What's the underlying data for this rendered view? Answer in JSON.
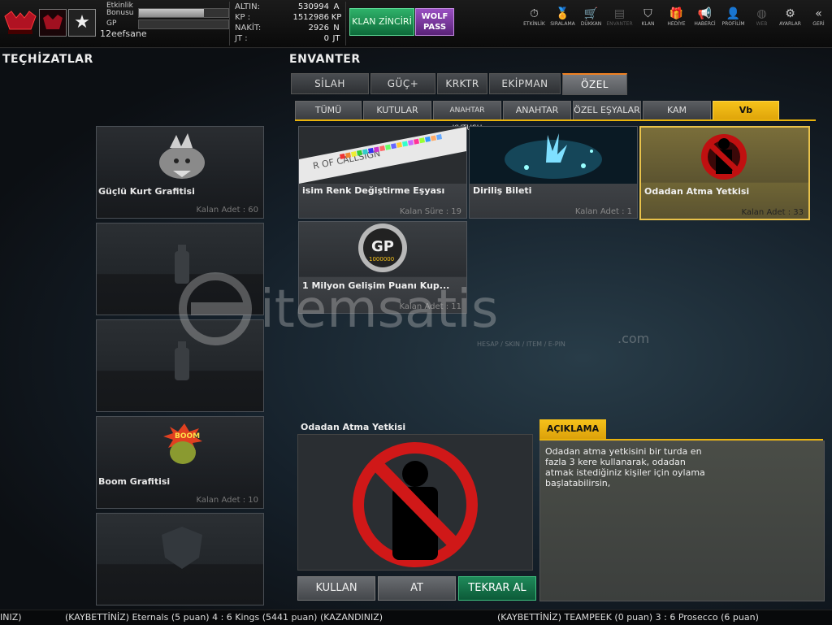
{
  "player": {
    "name": "12eefsane",
    "bonus_label": "Etkinlik Bonusu",
    "bonus_fill": 0.73,
    "gp_label": "GP",
    "gp_fill": 0.0
  },
  "currency": [
    {
      "label": "ALTIN:",
      "value": "530994",
      "unit": "A"
    },
    {
      "label": "KP   :",
      "value": "1512986",
      "unit": "KP"
    },
    {
      "label": "NAKİT:",
      "value": "2926",
      "unit": "N"
    },
    {
      "label": "JT   :",
      "value": "0",
      "unit": "JT"
    }
  ],
  "buttons": {
    "klan": "KLAN ZİNCİRİ",
    "wolf": "WOLF PASS"
  },
  "top_menu": [
    {
      "label": "ETKİNLİK",
      "icon": "stopwatch-icon",
      "glyph": "⏱",
      "dim": false
    },
    {
      "label": "SIRALAMA",
      "icon": "medal-icon",
      "glyph": "🏅",
      "dim": false
    },
    {
      "label": "DÜKKAN",
      "icon": "cart-icon",
      "glyph": "🛒",
      "dim": false
    },
    {
      "label": "ENVANTER",
      "icon": "inventory-icon",
      "glyph": "▤",
      "dim": true
    },
    {
      "label": "KLAN",
      "icon": "shield-icon",
      "glyph": "⛉",
      "dim": false
    },
    {
      "label": "HEDİYE",
      "icon": "gift-icon",
      "glyph": "🎁",
      "dim": false
    },
    {
      "label": "HABERCİ",
      "icon": "megaphone-icon",
      "glyph": "📢",
      "dim": false
    },
    {
      "label": "PROFİLİM",
      "icon": "profile-icon",
      "glyph": "👤",
      "dim": false
    },
    {
      "label": "WEB",
      "icon": "globe-icon",
      "glyph": "◍",
      "dim": true
    },
    {
      "label": "AYARLAR",
      "icon": "gear-icon",
      "glyph": "⚙",
      "dim": false
    },
    {
      "label": "GERİ",
      "icon": "back-chevron-icon",
      "glyph": "«",
      "dim": false
    }
  ],
  "headings": {
    "left": "TEÇHİZATLAR",
    "right": "ENVANTER"
  },
  "equipment": [
    {
      "name": "Güçlü Kurt Grafitisi",
      "count": "Kalan Adet : 60",
      "art": "wolf-graffiti"
    },
    {
      "name": "",
      "count": "",
      "art": "spray-can"
    },
    {
      "name": "",
      "count": "",
      "art": "spray-can"
    },
    {
      "name": "Boom Grafitisi",
      "count": "Kalan Adet : 10",
      "art": "boom-graffiti"
    },
    {
      "name": "",
      "count": "",
      "art": "shield"
    }
  ],
  "tabs": [
    "SİLAH",
    "GÜÇ+",
    "KRKTR",
    "EKİPMAN",
    "ÖZEL"
  ],
  "active_tab": 4,
  "subtabs": [
    "TÜMÜ",
    "KUTULAR",
    "ANAHTAR KUTUSU",
    "ANAHTAR",
    "ÖZEL EŞYALAR",
    "KAM",
    "Vb"
  ],
  "active_subtab": 6,
  "items": [
    {
      "name": "isim Renk Değiştirme Eşyası",
      "count": "Kalan Süre : 19",
      "art": "callsign"
    },
    {
      "name": "Diriliş Bileti",
      "count": "Kalan Adet : 1",
      "art": "resurrection"
    },
    {
      "name": "Odadan Atma Yetkisi",
      "count": "Kalan Adet : 33",
      "art": "kick"
    },
    {
      "name": "1 Milyon Gelişim Puanı Kup...",
      "count": "Kalan Adet : 11",
      "art": "gp-coin"
    }
  ],
  "selected_item": 2,
  "callsign_text": "R OF CALLSIGN",
  "gp_coin": {
    "top": "GP",
    "bottom": "1000000"
  },
  "detail": {
    "title": "Odadan Atma Yetkisi",
    "desc_head": "AÇIKLAMA",
    "desc": "Odadan atma yetkisini bir turda en fazla 3 kere kullanarak, odadan atmak istediğiniz kişiler için oylama başlatabilirsin,"
  },
  "actions": [
    "KULLAN",
    "AT",
    "TEKRAR AL"
  ],
  "ticker": [
    "INIZ)",
    "(KAYBETTİNİZ) Eternals (5 puan) 4 : 6 Kings (5441 puan) (KAZANDINIZ)",
    "(KAYBETTİNİZ) TEAMPEEK (0 puan) 3 : 6 Prosecco (6 puan)"
  ],
  "watermark": {
    "brand": "itemsatis",
    "suffix": ".com",
    "tagline": "HESAP / SKIN / ITEM / E-PIN"
  }
}
